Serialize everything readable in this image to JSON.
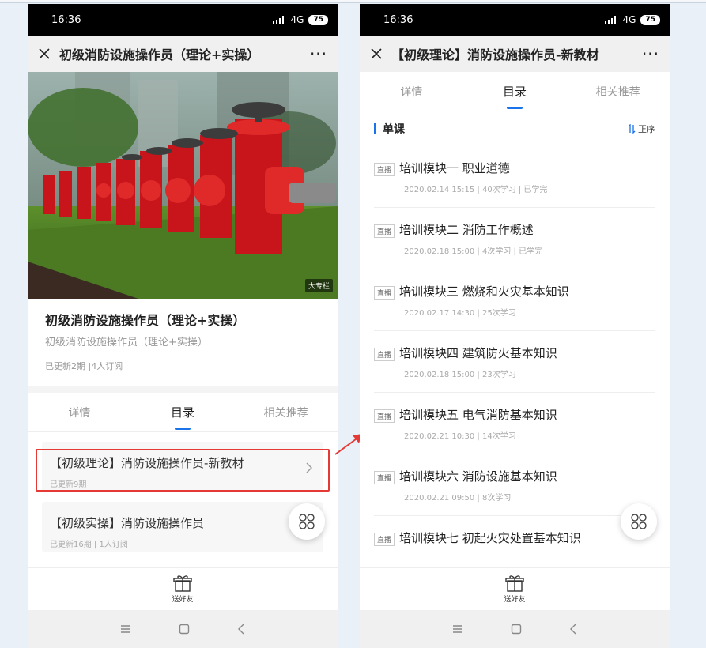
{
  "status": {
    "time": "16:36",
    "network": "4G",
    "battery": "75"
  },
  "left": {
    "title": "初级消防设施操作员（理论+实操）",
    "more": "···",
    "hero_badge": "大专栏",
    "course": {
      "title": "初级消防设施操作员（理论+实操）",
      "subtitle": "初级消防设施操作员（理论+实操）",
      "meta": "已更新2期 |4人订阅"
    },
    "tabs": [
      "详情",
      "目录",
      "相关推荐"
    ],
    "cards": [
      {
        "title": "【初级理论】消防设施操作员-新教材",
        "meta": "已更新9期"
      },
      {
        "title": "【初级实操】消防设施操作员",
        "meta": "已更新16期 | 1人订阅"
      }
    ],
    "gift_label": "送好友"
  },
  "right": {
    "title": "【初级理论】消防设施操作员-新教材",
    "more": "···",
    "tabs": [
      "详情",
      "目录",
      "相关推荐"
    ],
    "section_title": "单课",
    "sort_label": "正序",
    "lessons": [
      {
        "tag": "直播",
        "title": "培训模块一 职业道德",
        "meta": "2020.02.14 15:15 | 40次学习 | 已学完"
      },
      {
        "tag": "直播",
        "title": "培训模块二 消防工作概述",
        "meta": "2020.02.18 15:00 | 4次学习 | 已学完"
      },
      {
        "tag": "直播",
        "title": "培训模块三 燃烧和火灾基本知识",
        "meta": "2020.02.17 14:30 | 25次学习"
      },
      {
        "tag": "直播",
        "title": "培训模块四 建筑防火基本知识",
        "meta": "2020.02.18 15:00 | 23次学习"
      },
      {
        "tag": "直播",
        "title": "培训模块五 电气消防基本知识",
        "meta": "2020.02.21 10:30 | 14次学习"
      },
      {
        "tag": "直播",
        "title": "培训模块六 消防设施基本知识",
        "meta": "2020.02.21 09:50 | 8次学习"
      },
      {
        "tag": "直播",
        "title": "培训模块七 初起火灾处置基本知识",
        "meta": ""
      }
    ],
    "gift_label": "送好友"
  },
  "colors": {
    "accent": "#1a73e8",
    "highlight": "#e53935",
    "annotation_arrow": "#e53935"
  },
  "icons": [
    "close-icon",
    "more-icon",
    "chevron-right-icon",
    "grid-icon",
    "gift-icon",
    "menu-icon",
    "home-icon",
    "back-icon",
    "sort-icon"
  ]
}
